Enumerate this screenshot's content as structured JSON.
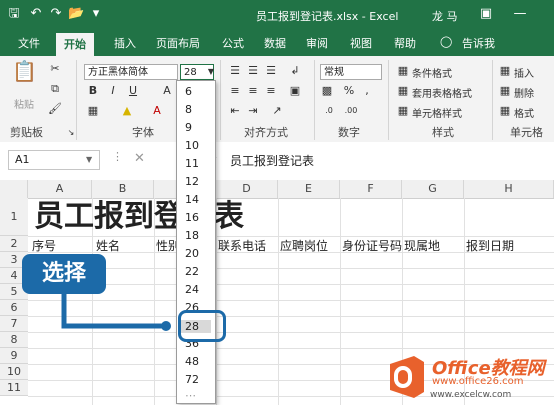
{
  "window": {
    "title": "员工报到登记表.xlsx - Excel",
    "user": "龙 马"
  },
  "tabs": [
    "文件",
    "开始",
    "插入",
    "页面布局",
    "公式",
    "数据",
    "审阅",
    "视图",
    "帮助",
    "告诉我"
  ],
  "ribbon": {
    "clipboard": {
      "paste": "粘贴",
      "label": "剪贴板"
    },
    "font": {
      "name": "方正黑体简体",
      "size": "28",
      "label": "字体"
    },
    "alignment": {
      "label": "对齐方式"
    },
    "number": {
      "format": "常规",
      "label": "数字"
    },
    "styles": {
      "conditional": "条件格式",
      "table": "套用表格格式",
      "cell": "单元格样式",
      "label": "样式"
    },
    "cells": {
      "insert": "插入",
      "delete": "删除",
      "format": "格式",
      "label": "单元格"
    }
  },
  "formula_bar": {
    "name_box": "A1",
    "fx": "fx",
    "content": "员工报到登记表"
  },
  "columns": [
    "A",
    "B",
    "C",
    "D",
    "E",
    "F",
    "G",
    "H"
  ],
  "rows": [
    "1",
    "2",
    "3",
    "4",
    "5",
    "6",
    "7",
    "8",
    "9",
    "10",
    "11"
  ],
  "sheet": {
    "title": "员工报到登记表",
    "headers": [
      "序号",
      "姓名",
      "性别",
      "联系电话",
      "应聘岗位",
      "身份证号码",
      "现属地",
      "报到日期"
    ]
  },
  "font_size_list": [
    "6",
    "8",
    "9",
    "10",
    "11",
    "12",
    "14",
    "16",
    "18",
    "20",
    "22",
    "24",
    "26",
    "28",
    "36",
    "48",
    "72"
  ],
  "selected_size": "28",
  "callout": {
    "label": "选择"
  },
  "watermark": {
    "brand": "Office教程网",
    "url": "www.office26.com",
    "url2": "www.excelcw.com"
  },
  "colors": {
    "excel_green": "#217346",
    "callout_blue": "#1c6aa8",
    "logo_orange": "#e8612c"
  }
}
